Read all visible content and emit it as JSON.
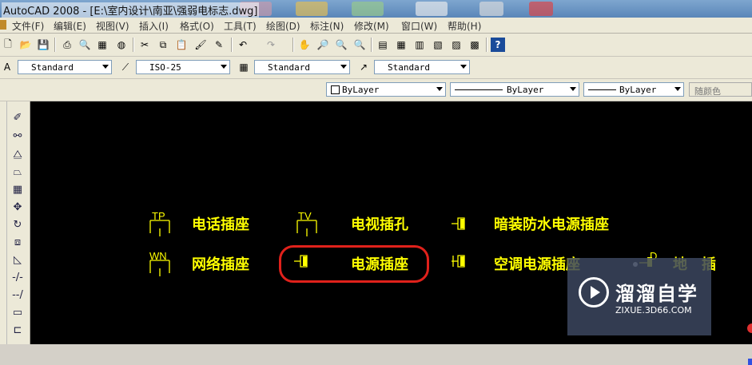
{
  "window": {
    "title": "AutoCAD 2008 - [E:\\室内设计\\南亚\\强弱电标志.dwg]"
  },
  "menu": [
    "文件(F)",
    "编辑(E)",
    "视图(V)",
    "插入(I)",
    "格式(O)",
    "工具(T)",
    "绘图(D)",
    "标注(N)",
    "修改(M)",
    "窗口(W)",
    "帮助(H)"
  ],
  "styles_toolbar": {
    "text_style": "Standard",
    "dim_style": "ISO-25",
    "table_style": "Standard",
    "mleader_style": "Standard"
  },
  "properties_toolbar": {
    "color": "ByLayer",
    "linetype": "ByLayer",
    "lineweight": "ByLayer",
    "plotstyle": "随颜色"
  },
  "drawing": {
    "labels": {
      "phone": "电话插座",
      "tv": "电视插孔",
      "hidden_waterproof": "暗装防水电源插座",
      "network": "网络插座",
      "power": "电源插座",
      "ac": "空调电源插座",
      "floor": "地　插"
    },
    "symbols": {
      "phone": "TP",
      "tv": "TV",
      "network": "WN",
      "floor": "D"
    },
    "colors": {
      "text": "#ffff00",
      "highlight": "#e0211b",
      "background": "#000000"
    }
  },
  "watermark": {
    "title": "溜溜自学",
    "url": "ZIXUE.3D66.COM"
  }
}
